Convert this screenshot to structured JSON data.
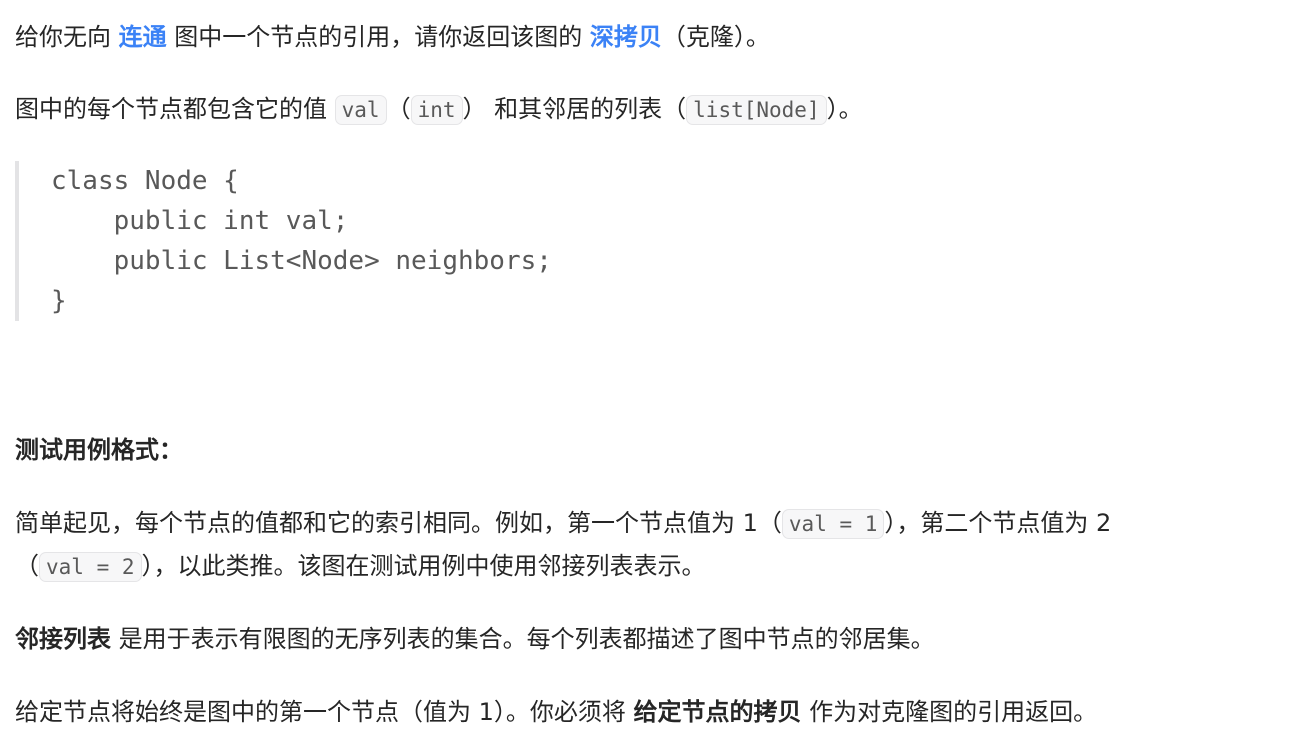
{
  "intro": {
    "p1_before": "给你无向 ",
    "p1_link1": "连通",
    "p1_mid": " 图中一个节点的引用，请你返回该图的 ",
    "p1_link2": "深拷贝",
    "p1_after": "（克隆）。",
    "p2_before": "图中的每个节点都包含它的值 ",
    "p2_code1": "val",
    "p2_paren_open": "（",
    "p2_code2": "int",
    "p2_mid": "） 和其邻居的列表（",
    "p2_code3": "list[Node]",
    "p2_after": "）。"
  },
  "codeblock": {
    "lines": [
      "class Node {",
      "    public int val;",
      "    public List<Node> neighbors;",
      "}"
    ]
  },
  "format": {
    "heading": "测试用例格式：",
    "p1_a": "简单起见，每个节点的值都和它的索引相同。例如，第一个节点值为 1（",
    "p1_code1": "val = 1",
    "p1_b": "），第二个节点值为 2",
    "p1_c": "（",
    "p1_code2": "val = 2",
    "p1_d": "），以此类推。该图在测试用例中使用邻接列表表示。",
    "p2_bold": "邻接列表",
    "p2_rest": " 是用于表示有限图的无序列表的集合。每个列表都描述了图中节点的邻居集。",
    "p3_before": "给定节点将始终是图中的第一个节点（值为 1）。你必须将 ",
    "p3_bold": "给定节点的拷贝",
    "p3_after": " 作为对克隆图的引用返回。"
  }
}
